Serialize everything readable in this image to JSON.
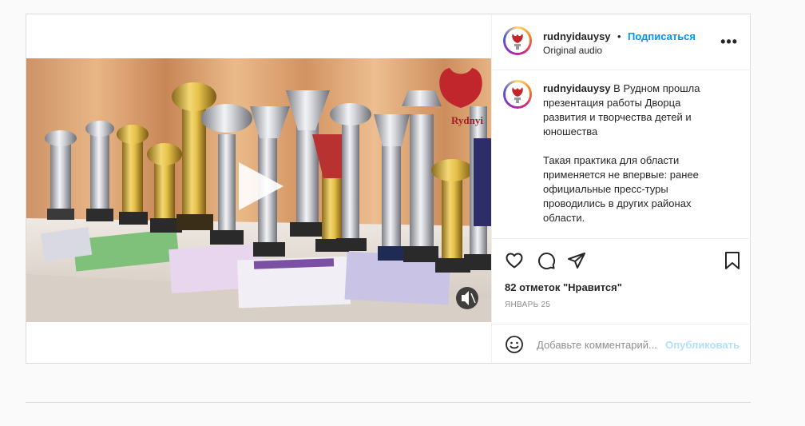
{
  "header": {
    "username": "rudnyidauysy",
    "separator": "•",
    "follow_label": "Подписаться",
    "audio_label": "Original audio",
    "more_label": "•••"
  },
  "caption": {
    "username": "rudnyidauysy",
    "paragraph1": "В Рудном прошла презентация работы Дворца развития и творчества детей и юношества",
    "paragraph2": "Такая практика для области применяется не впервые: ранее официальные пресс-туры проводились в других районах области."
  },
  "video": {
    "watermark": "Rydnyi",
    "play_icon": "play-icon",
    "mute_icon": "mute-icon"
  },
  "actions": {
    "icons": [
      "heart-icon",
      "comment-icon",
      "share-icon",
      "bookmark-icon"
    ]
  },
  "likes_text": "82 отметок \"Нравится\"",
  "date_text": "ЯНВАРЬ 25",
  "comment_box": {
    "placeholder": "Добавьте комментарий...",
    "publish_label": "Опубликовать"
  },
  "colors": {
    "accent": "#0095f6",
    "publish_disabled": "#b2dffc",
    "border": "#dbdbdb"
  }
}
